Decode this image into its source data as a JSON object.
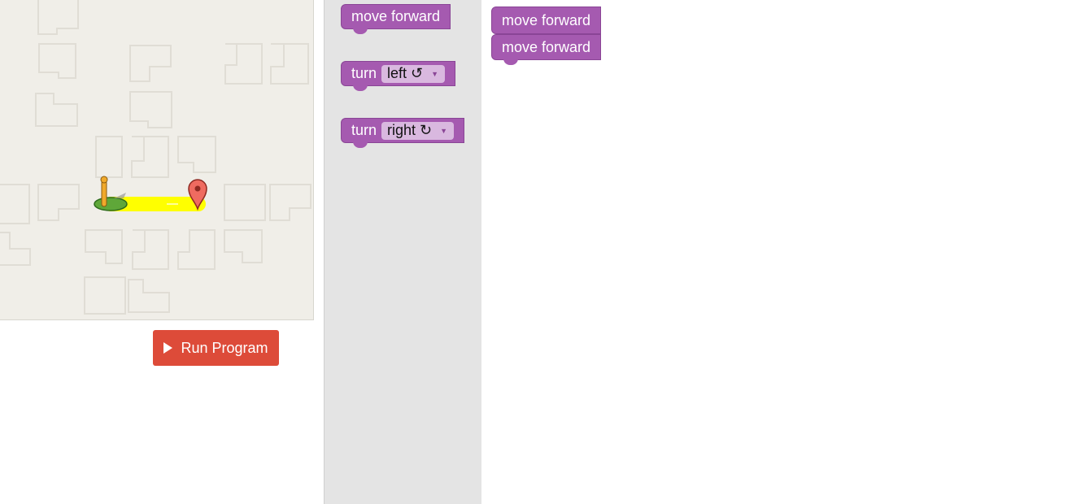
{
  "run_button": {
    "label": "Run Program",
    "icon": "play-icon"
  },
  "toolbox": {
    "blocks": [
      {
        "label": "move forward"
      },
      {
        "label": "turn",
        "option": "left ↺"
      },
      {
        "label": "turn",
        "option": "right ↻"
      }
    ]
  },
  "workspace": {
    "blocks": [
      {
        "label": "move forward"
      },
      {
        "label": "move forward"
      }
    ]
  },
  "colors": {
    "block": "#a55ab0",
    "run_button": "#dd4b39",
    "path": "#ffff00",
    "maze_bg": "#f0eee8"
  },
  "maze": {
    "start_icon": "pegman-start-icon",
    "goal_icon": "goal-marker-icon"
  }
}
